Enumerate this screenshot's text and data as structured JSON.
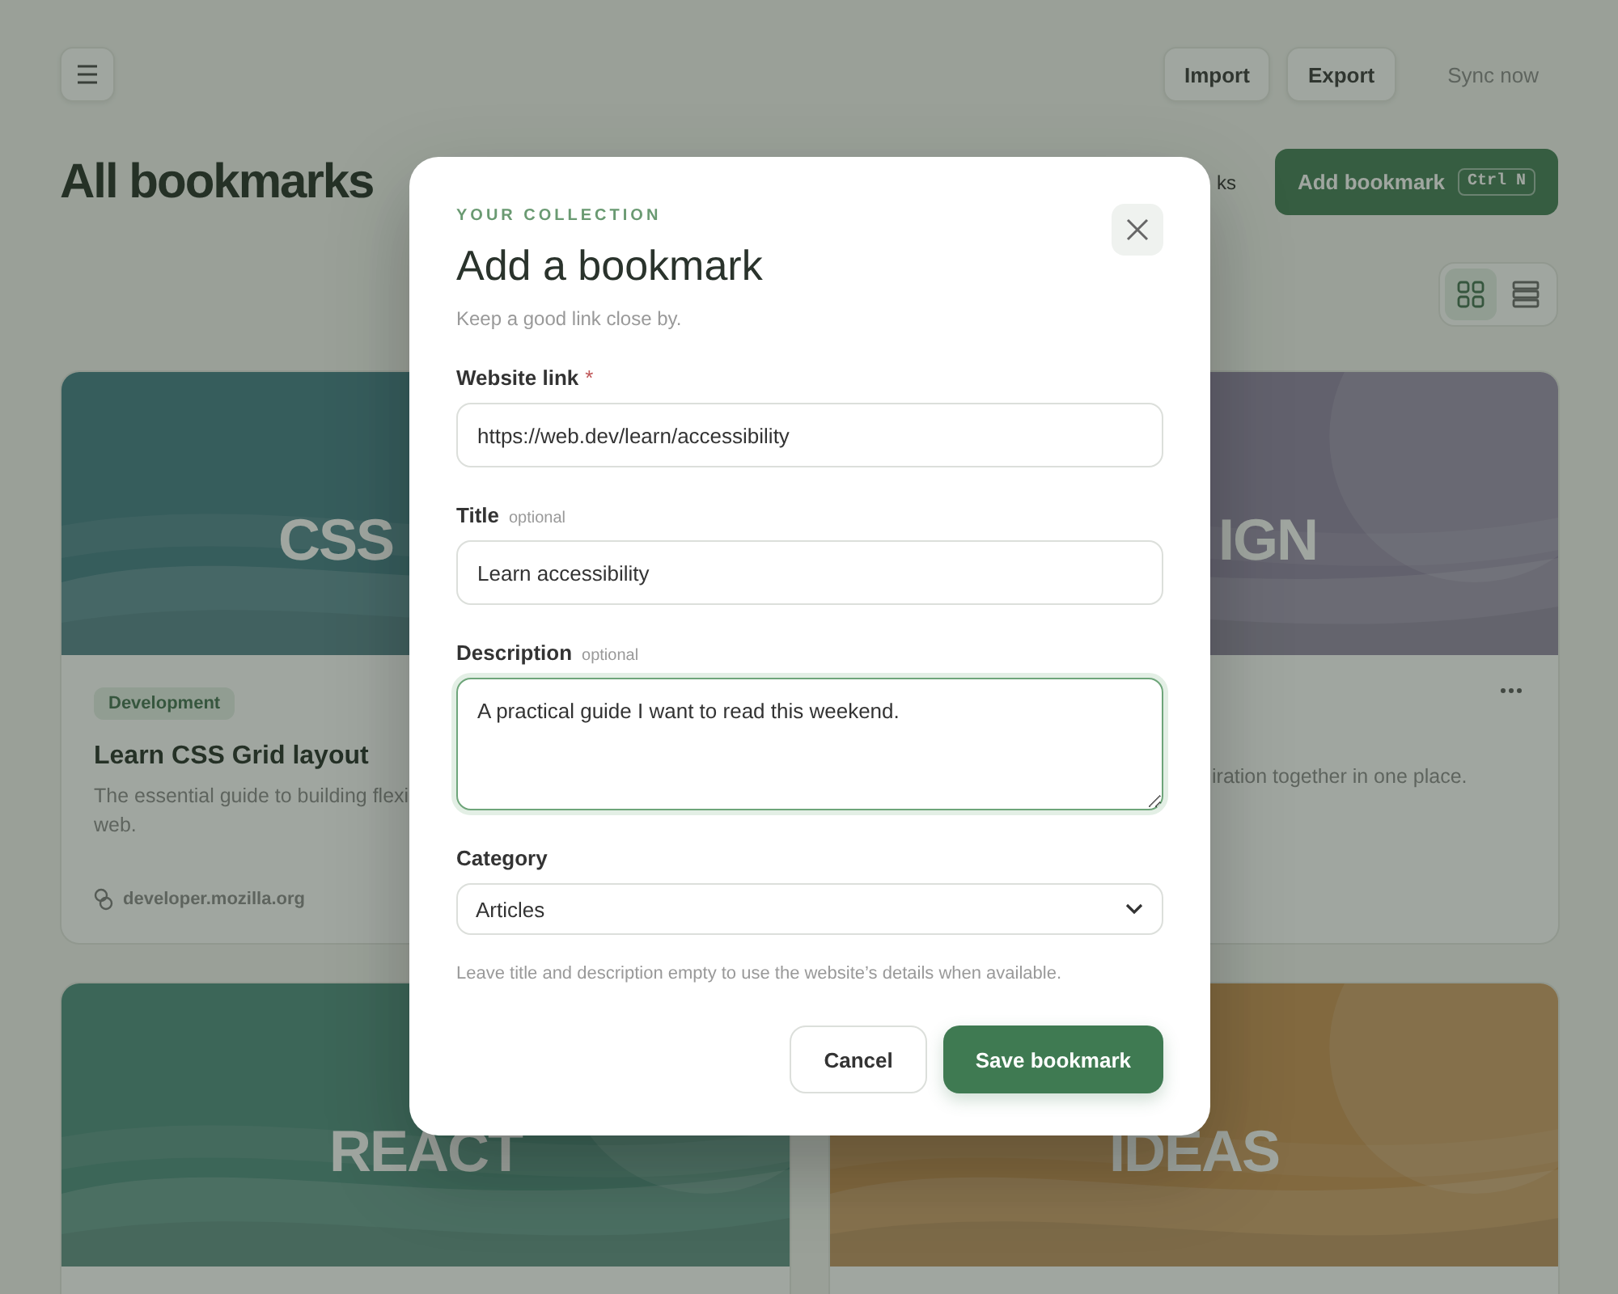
{
  "toolbar": {
    "buttons": [
      {
        "label": "Import",
        "kind": "outlined"
      },
      {
        "label": "Export",
        "kind": "outlined"
      },
      {
        "label": "Sync now",
        "kind": "plain"
      }
    ]
  },
  "header": {
    "title": "All bookmarks",
    "count_fragment": "ks",
    "primary": {
      "label": "Add bookmark",
      "shortcut": "Ctrl N"
    }
  },
  "view_toggle": [
    {
      "kind": "grid",
      "selected": true
    },
    {
      "kind": "list",
      "selected": false
    }
  ],
  "cards": [
    {
      "cover_text": "CSS",
      "tag": "Development",
      "title": "Learn CSS Grid layout",
      "desc_lines": [
        "The essential guide to building flexi",
        "web."
      ],
      "domain": "developer.mozilla.org",
      "more": false
    },
    {
      "cover_text": "IGN",
      "desc_lines": [
        "iration together in one place."
      ],
      "more": true
    },
    {
      "cover_text": "REACT",
      "more": false
    },
    {
      "cover_text": "IDEAS",
      "more": false
    }
  ],
  "dialog": {
    "eyebrow": "YOUR COLLECTION",
    "title": "Add a bookmark",
    "subtitle": "Keep a good link close by.",
    "fields": [
      {
        "kind": "text",
        "label": "Website link",
        "required_mark": "*",
        "value": "https://web.dev/learn/accessibility",
        "focused": false
      },
      {
        "kind": "text",
        "label": "Title",
        "note": "optional",
        "value": "Learn accessibility",
        "focused": false
      },
      {
        "kind": "textarea",
        "label": "Description",
        "note": "optional",
        "value": "A practical guide I want to read this weekend.",
        "focused": true
      },
      {
        "kind": "select",
        "label": "Category",
        "value": "Articles",
        "focused": false
      }
    ],
    "hint": "Leave title and description empty to use the website’s details when available.",
    "buttons": [
      {
        "label": "Cancel",
        "kind": "secondary"
      },
      {
        "label": "Save bookmark",
        "kind": "primary"
      }
    ]
  }
}
